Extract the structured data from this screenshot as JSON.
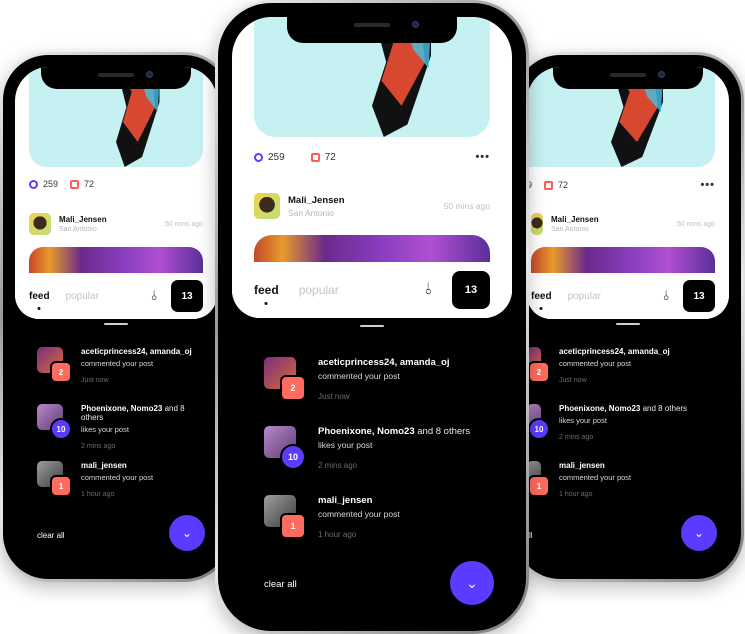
{
  "post": {
    "likes": "259",
    "comments": "72",
    "more": "•••",
    "author": "Mali_Jensen",
    "location": "San Antonio",
    "time": "50 mins ago"
  },
  "tabs": {
    "feed": "feed",
    "popular": "popular",
    "count": "13"
  },
  "notifications": [
    {
      "names": "aceticprincess24, amanda_oj",
      "rest": "",
      "action": "commented your post",
      "time": "Just now",
      "count": "2"
    },
    {
      "names": "Phoenixone, Nomo23",
      "rest": " and 8 others",
      "action": "likes your post",
      "time": "2 mins ago",
      "count": "10"
    },
    {
      "names": "mali_jensen",
      "rest": "",
      "action": "commented your post",
      "time": "1 hour ago",
      "count": "1"
    }
  ],
  "footer": {
    "clear_all": "clear all",
    "fab_icon": "⌄"
  },
  "icons": {
    "filter": "⫰"
  },
  "colors": {
    "accent": "#5b3bff",
    "badge_red": "#ff6b5e",
    "hero_bg": "#c6f1f2"
  }
}
